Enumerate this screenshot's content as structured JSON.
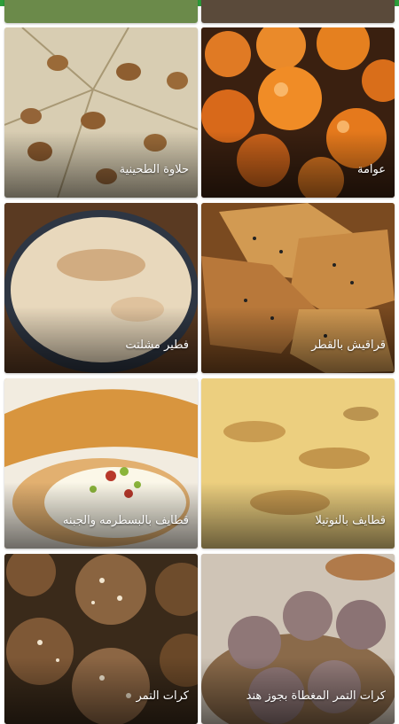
{
  "status_bar": {
    "color": "#2e9e3a"
  },
  "recipes": [
    {
      "title": "عوامة"
    },
    {
      "title": "حلاوة الطحينية"
    },
    {
      "title": "قراقيش بالقطر"
    },
    {
      "title": "فطير مشلتت"
    },
    {
      "title": "قطايف بالنوتيلا"
    },
    {
      "title": "قطايف بالبسطرمه والجبنه"
    },
    {
      "title": "كرات التمر المغطاة بجوز هند"
    },
    {
      "title": "كرات التمر"
    }
  ]
}
